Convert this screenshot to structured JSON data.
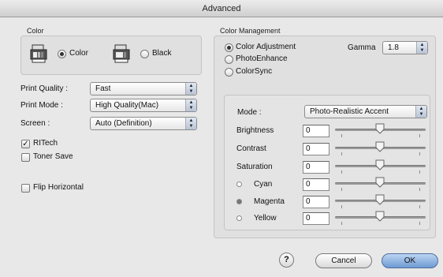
{
  "window": {
    "title": "Advanced"
  },
  "color_group": {
    "label": "Color",
    "color_option": "Color",
    "black_option": "Black",
    "selected": "Color"
  },
  "print_settings": {
    "print_quality_label": "Print Quality :",
    "print_quality_value": "Fast",
    "print_mode_label": "Print Mode :",
    "print_mode_value": "High Quality(Mac)",
    "screen_label": "Screen :",
    "screen_value": "Auto (Definition)"
  },
  "options": {
    "ritech_label": "RITech",
    "ritech_checked": true,
    "toner_save_label": "Toner Save",
    "toner_save_checked": false,
    "flip_horizontal_label": "Flip Horizontal",
    "flip_horizontal_checked": false
  },
  "color_management": {
    "label": "Color Management",
    "options": [
      "Color Adjustment",
      "PhotoEnhance",
      "ColorSync"
    ],
    "selected": "Color Adjustment",
    "gamma_label": "Gamma",
    "gamma_value": "1.8",
    "mode_label": "Mode :",
    "mode_value": "Photo-Realistic Accent",
    "sliders": [
      {
        "label": "Brightness",
        "value": "0",
        "fraction": 0.5
      },
      {
        "label": "Contrast",
        "value": "0",
        "fraction": 0.5
      },
      {
        "label": "Saturation",
        "value": "0",
        "fraction": 0.5
      },
      {
        "label": "Cyan",
        "value": "0",
        "fraction": 0.5
      },
      {
        "label": "Magenta",
        "value": "0",
        "fraction": 0.5
      },
      {
        "label": "Yellow",
        "value": "0",
        "fraction": 0.5
      }
    ]
  },
  "buttons": {
    "help": "?",
    "cancel": "Cancel",
    "ok": "OK"
  },
  "icons": {
    "printer_color": "printer-color-icon",
    "printer_black": "printer-black-icon",
    "help": "help-icon"
  }
}
